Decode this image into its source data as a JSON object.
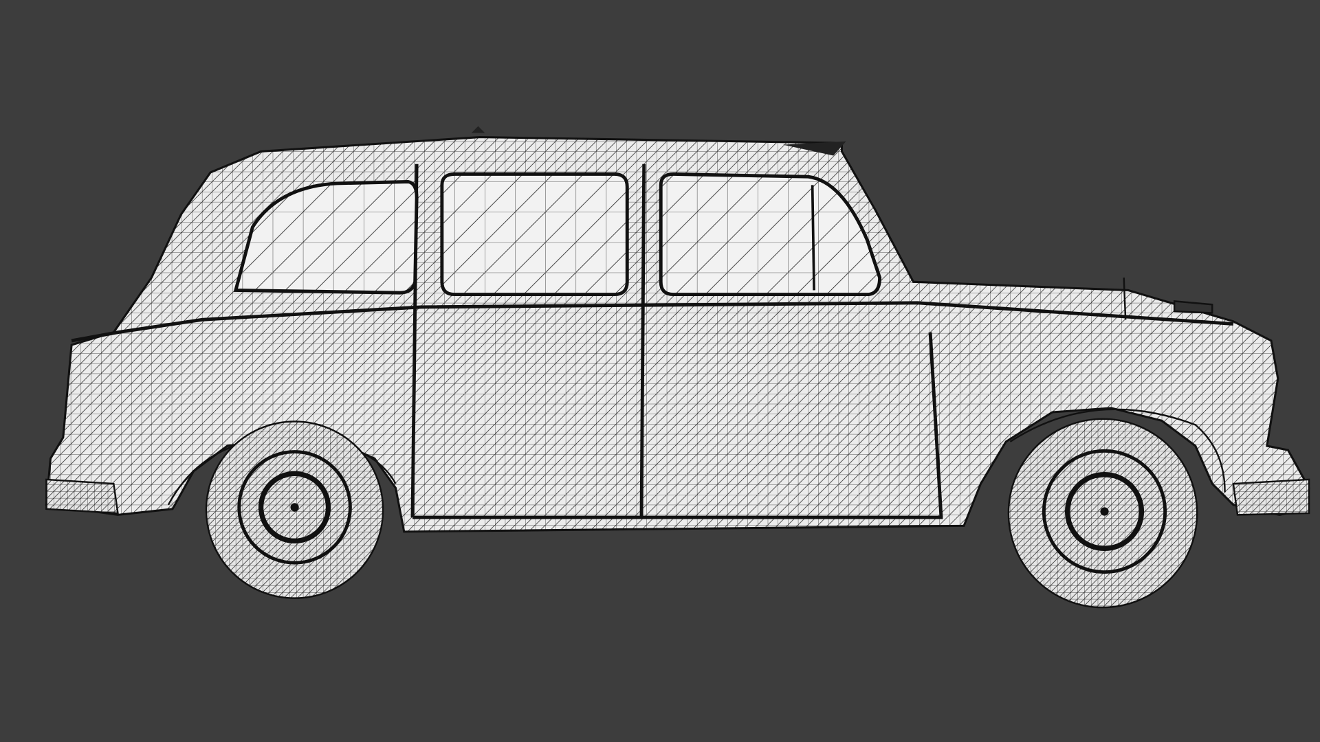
{
  "colors": {
    "background": "#3d3d3d",
    "mesh_fill": "#ececec",
    "glass_fill": "#f2f2f2",
    "wire": "#1c1c1c",
    "tire_fill": "#e6e6e6"
  }
}
